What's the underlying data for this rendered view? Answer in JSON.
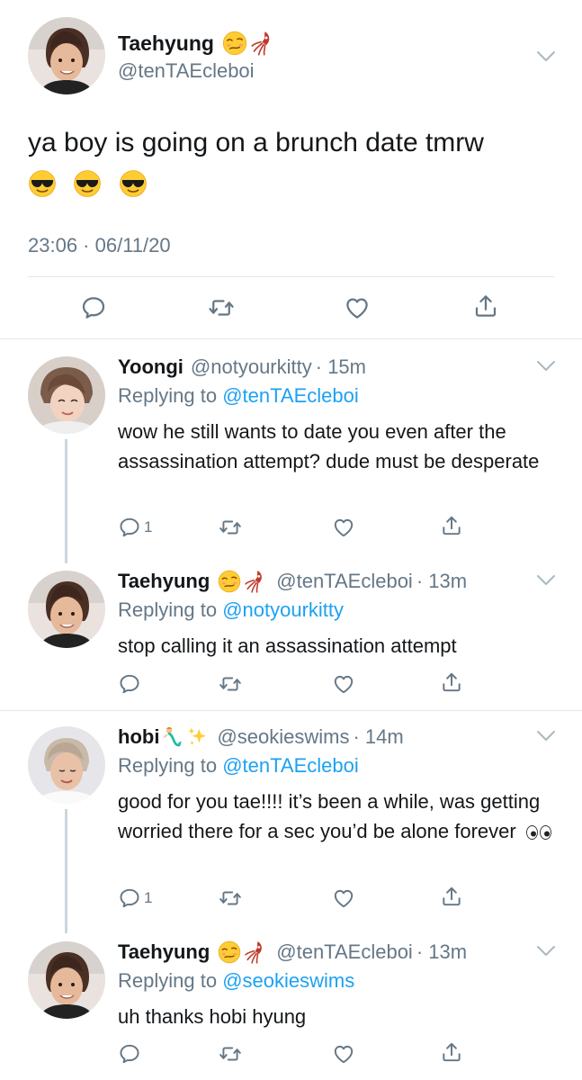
{
  "main_tweet": {
    "name": "Taehyung",
    "handle": "@tenTAEcleboi",
    "text": "ya boy is going on a brunch date tmrw",
    "emojis": [
      "smiling-face-with-sunglasses",
      "smiling-face-with-sunglasses",
      "smiling-face-with-sunglasses"
    ],
    "timestamp": "23:06 · 06/11/20"
  },
  "replies": [
    {
      "name": "Yoongi",
      "handle": "@notyourkitty",
      "time": "· 15m",
      "replying_label": "Replying to",
      "replying_to": "@tenTAEcleboi",
      "text": "wow he still wants to date you even after the assassination attempt? dude must be desperate",
      "reply_count": "1"
    },
    {
      "name": "Taehyung",
      "handle": "@tenTAEcleboi",
      "time": "· 13m",
      "replying_label": "Replying to",
      "replying_to": "@notyourkitty",
      "text": "stop calling it an assassination attempt",
      "reply_count": ""
    },
    {
      "name": "hobi",
      "handle": "@seokieswims",
      "time": "· 14m",
      "replying_label": "Replying to",
      "replying_to": "@tenTAEcleboi",
      "text": "good for you tae!!!! it’s been a while, was getting worried there for a sec you’d be alone forever",
      "reply_count": "1"
    },
    {
      "name": "Taehyung",
      "handle": "@tenTAEcleboi",
      "time": "· 13m",
      "replying_label": "Replying to",
      "replying_to": "@seokieswims",
      "text": "uh thanks hobi hyung",
      "reply_count": ""
    }
  ],
  "colors": {
    "accent": "#1da1f2",
    "secondary_text": "#657786",
    "divider": "#e1e8ed"
  }
}
